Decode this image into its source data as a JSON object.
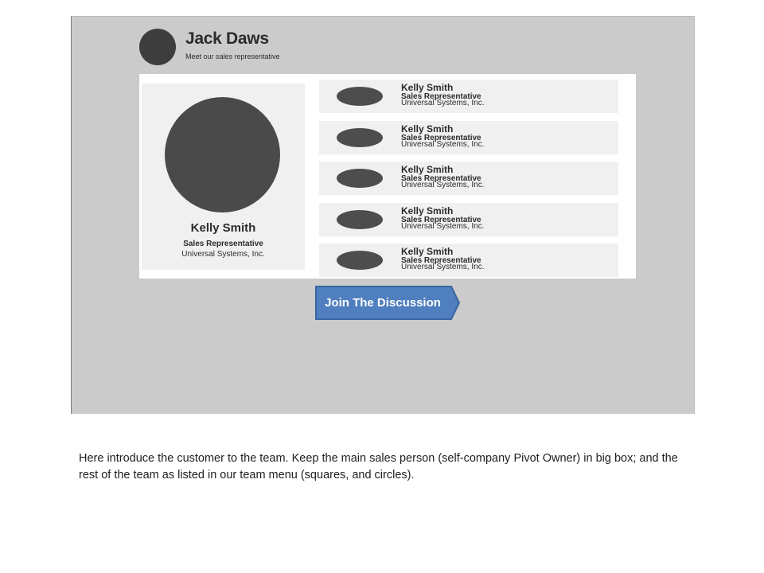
{
  "header": {
    "name": "Jack Daws",
    "subtitle": "Meet our sales representative"
  },
  "main_rep": {
    "name": "Kelly Smith",
    "title": "Sales Representative",
    "company": "Universal Systems, Inc."
  },
  "team": [
    {
      "name": "Kelly Smith",
      "title": "Sales Representative",
      "company": "Universal Systems, Inc."
    },
    {
      "name": "Kelly Smith",
      "title": "Sales Representative",
      "company": "Universal Systems, Inc."
    },
    {
      "name": "Kelly Smith",
      "title": "Sales Representative",
      "company": "Universal Systems, Inc."
    },
    {
      "name": "Kelly Smith",
      "title": "Sales Representative",
      "company": "Universal Systems, Inc."
    },
    {
      "name": "Kelly Smith",
      "title": "Sales Representative",
      "company": "Universal Systems, Inc."
    }
  ],
  "join_button": {
    "label": "Join The Discussion",
    "color": "#4f7fbf"
  },
  "caption": "Here introduce the customer to the team. Keep the main sales person (self-company Pivot Owner) in big box; and the rest of the team as listed in our team menu (squares, and circles)."
}
